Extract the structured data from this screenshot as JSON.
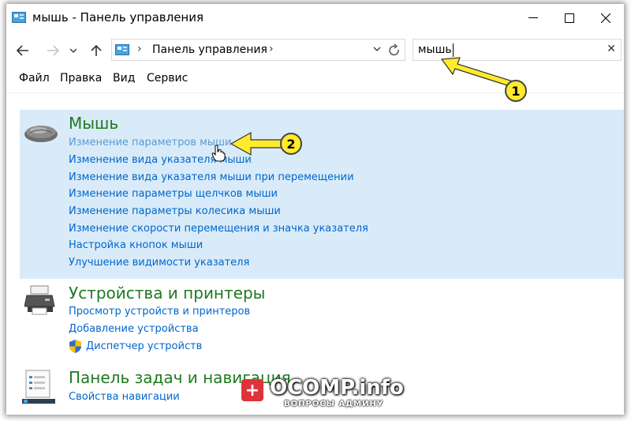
{
  "window": {
    "title": "мышь - Панель управления"
  },
  "address_bar": {
    "path": "Панель управления"
  },
  "search": {
    "value": "мышь"
  },
  "menu": {
    "items": [
      "Файл",
      "Правка",
      "Вид",
      "Сервис"
    ]
  },
  "groups": [
    {
      "title": "Мышь",
      "links": [
        "Изменение параметров мыши",
        "Изменение вида указателя мыши",
        "Изменение вида указателя мыши при перемещении",
        "Изменение параметры щелчков мыши",
        "Изменение параметры колесика мыши",
        "Изменение скорости перемещения и значка указателя",
        "Настройка кнопок мыши",
        "Улучшение видимости указателя"
      ]
    },
    {
      "title": "Устройства и принтеры",
      "links": [
        "Просмотр устройств и принтеров",
        "Добавление устройства",
        "Диспетчер устройств"
      ]
    },
    {
      "title": "Панель задач и навигация",
      "links": [
        "Свойства навигации"
      ]
    }
  ],
  "annotations": {
    "badge_1": "1",
    "badge_2": "2",
    "color": "#ffeb2b"
  },
  "watermark": {
    "brand": "OCOMP.info",
    "tagline": "ВОПРОСЫ АДМИНУ"
  },
  "colors": {
    "link": "#0066cc",
    "group_title": "#1e7a1e",
    "highlight": "#d9ebf9"
  }
}
